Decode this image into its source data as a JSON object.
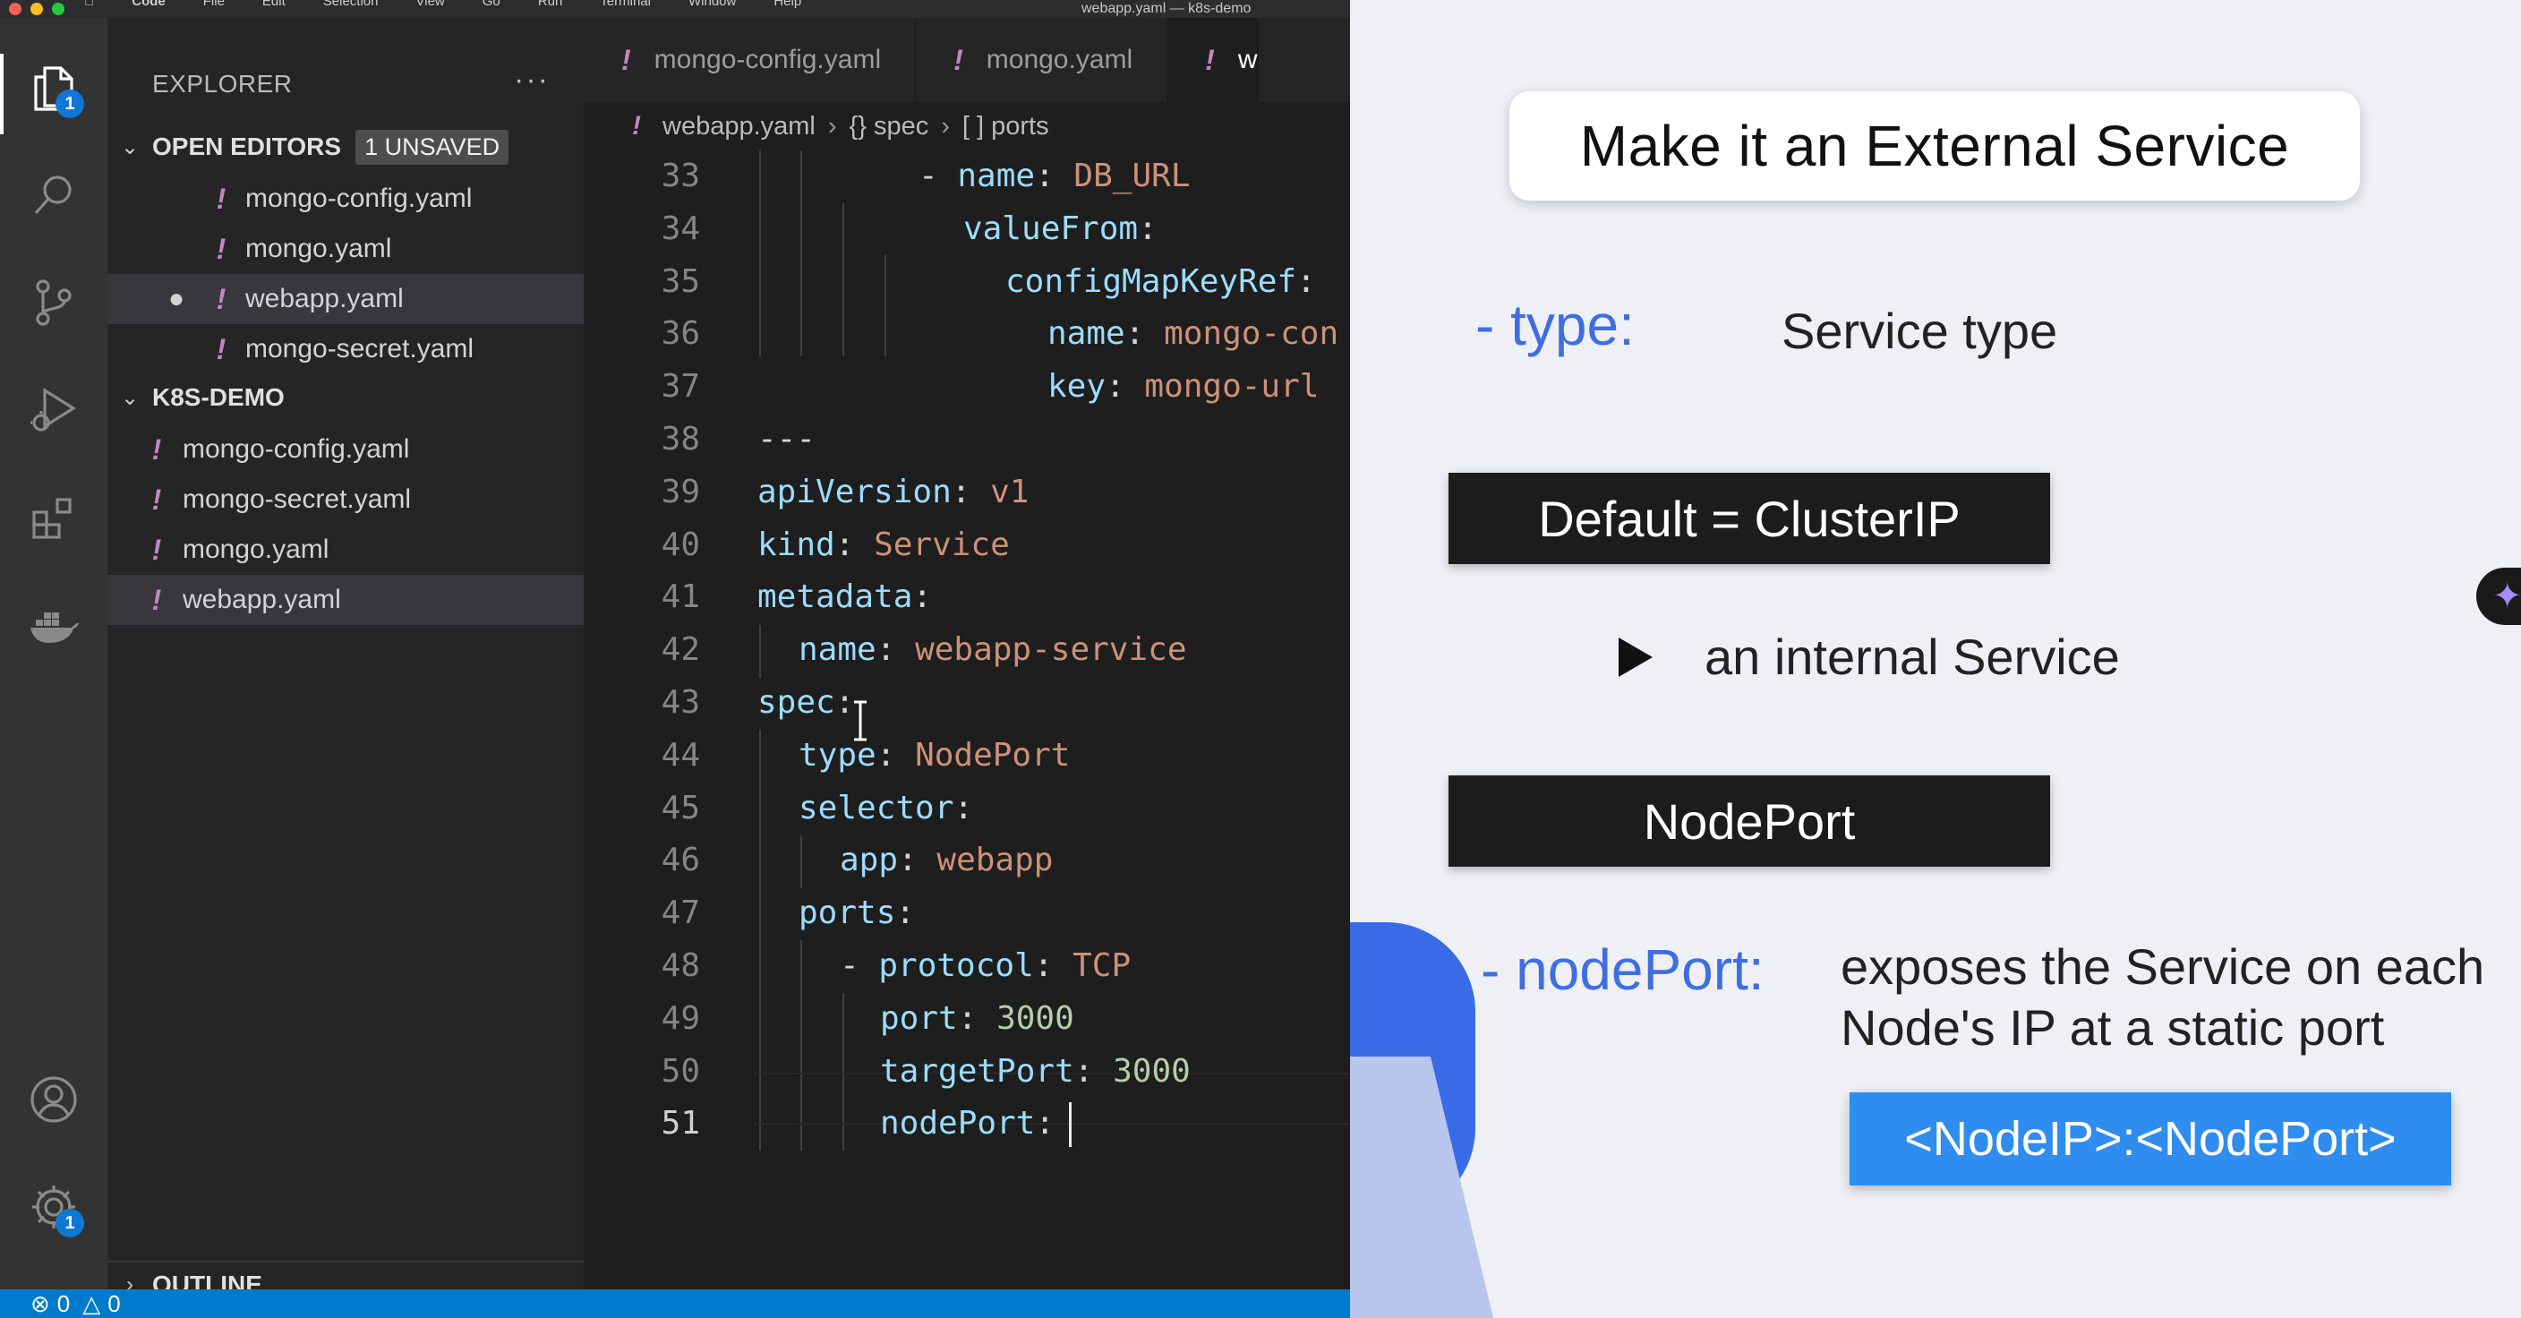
{
  "menubar": {
    "items": [
      "Code",
      "File",
      "Edit",
      "Selection",
      "View",
      "Go",
      "Run",
      "Terminal",
      "Window",
      "Help"
    ],
    "window_title": "webapp.yaml — k8s-demo"
  },
  "activity": {
    "explorer_badge": "1",
    "settings_badge": "1"
  },
  "sidebar": {
    "title": "EXPLORER",
    "more": "···",
    "open_editors_label": "OPEN EDITORS",
    "unsaved_badge": "1 UNSAVED",
    "open_editors": [
      "mongo-config.yaml",
      "mongo.yaml",
      "webapp.yaml",
      "mongo-secret.yaml"
    ],
    "project_label": "K8S-DEMO",
    "files": [
      "mongo-config.yaml",
      "mongo-secret.yaml",
      "mongo.yaml",
      "webapp.yaml"
    ],
    "outline_label": "OUTLINE"
  },
  "editor": {
    "tabs": [
      "mongo-config.yaml",
      "mongo.yaml",
      "w"
    ],
    "breadcrumb": {
      "file": "webapp.yaml",
      "spec": "{} spec",
      "ports": "[ ] ports"
    },
    "line_numbers": [
      "33",
      "34",
      "35",
      "36",
      "37",
      "38",
      "39",
      "40",
      "41",
      "42",
      "43",
      "44",
      "45",
      "46",
      "47",
      "48",
      "49",
      "50",
      "51"
    ],
    "lines": {
      "l33": {
        "dash": "- ",
        "key": "name",
        "colon": ": ",
        "val": "DB_URL"
      },
      "l34": {
        "key": "valueFrom",
        "colon": ":"
      },
      "l35": {
        "key": "configMapKeyRef",
        "colon": ":"
      },
      "l36": {
        "key": "name",
        "colon": ": ",
        "val": "mongo-con"
      },
      "l37": {
        "key": "key",
        "colon": ": ",
        "val": "mongo-url"
      },
      "l38": {
        "text": "---"
      },
      "l39": {
        "key": "apiVersion",
        "colon": ": ",
        "val": "v1"
      },
      "l40": {
        "key": "kind",
        "colon": ": ",
        "val": "Service"
      },
      "l41": {
        "key": "metadata",
        "colon": ":"
      },
      "l42": {
        "key": "name",
        "colon": ": ",
        "val": "webapp-service"
      },
      "l43": {
        "key": "spec",
        "colon": ":"
      },
      "l44": {
        "key": "type",
        "colon": ": ",
        "val": "NodePort"
      },
      "l45": {
        "key": "selector",
        "colon": ":"
      },
      "l46": {
        "key": "app",
        "colon": ": ",
        "val": "webapp"
      },
      "l47": {
        "key": "ports",
        "colon": ":"
      },
      "l48": {
        "dash": "- ",
        "key": "protocol",
        "colon": ": ",
        "val": "TCP"
      },
      "l49": {
        "key": "port",
        "colon": ": ",
        "num": "3000"
      },
      "l50": {
        "key": "targetPort",
        "colon": ": ",
        "num": "3000"
      },
      "l51": {
        "key": "nodePort",
        "colon": ":"
      }
    }
  },
  "statusbar": {
    "errors": "0",
    "warnings": "0"
  },
  "slide": {
    "title": "Make it an External Service",
    "type_label": "- type:",
    "type_desc": "Service type",
    "default_box": "Default = ClusterIP",
    "internal_text": "an internal Service",
    "nodeport_box": "NodePort",
    "nodeport_label": "- nodePort:",
    "nodeport_desc_1": "exposes the Service on each",
    "nodeport_desc_2": "Node's IP at a static port",
    "address_box": "<NodeIP>:<NodePort>"
  },
  "colors": {
    "yaml_key": "#9cdcfe",
    "yaml_string": "#ce9178",
    "yaml_number": "#b5cea8",
    "yaml_icon": "#c586c0",
    "statusbar": "#007acc",
    "slide_accent": "#3f6ee0",
    "address_box": "#2f8df0"
  },
  "icons": [
    "explorer-icon",
    "search-icon",
    "source-control-icon",
    "run-debug-icon",
    "extensions-icon",
    "docker-icon",
    "account-icon",
    "settings-gear-icon",
    "sparkle-icon",
    "play-triangle-icon"
  ]
}
